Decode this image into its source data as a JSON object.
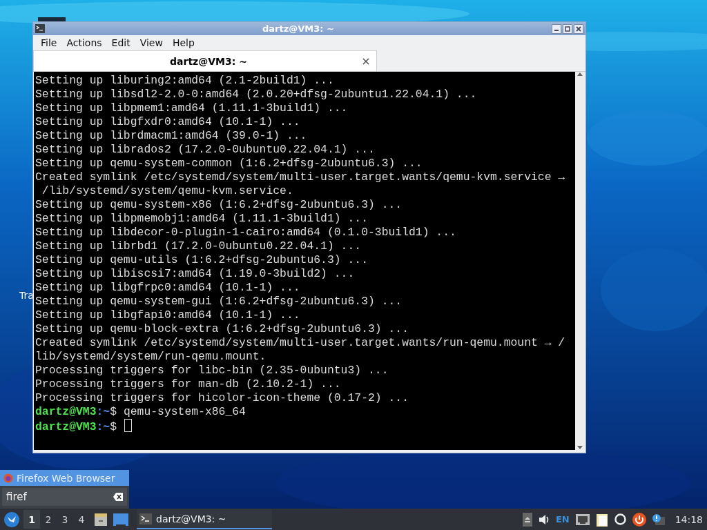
{
  "desktop": {
    "icon_labels": [
      "Tra"
    ]
  },
  "window": {
    "title": "dartz@VM3: ~",
    "menu": [
      "File",
      "Actions",
      "Edit",
      "View",
      "Help"
    ],
    "tabs": [
      {
        "label": "dartz@VM3: ~",
        "selected": true
      }
    ],
    "terminal": {
      "lines": [
        {
          "kind": "output",
          "text": "Setting up liburing2:amd64 (2.1-2build1) ..."
        },
        {
          "kind": "output",
          "text": "Setting up libsdl2-2.0-0:amd64 (2.0.20+dfsg-2ubuntu1.22.04.1) ..."
        },
        {
          "kind": "output",
          "text": "Setting up libpmem1:amd64 (1.11.1-3build1) ..."
        },
        {
          "kind": "output",
          "text": "Setting up libgfxdr0:amd64 (10.1-1) ..."
        },
        {
          "kind": "output",
          "text": "Setting up librdmacm1:amd64 (39.0-1) ..."
        },
        {
          "kind": "output",
          "text": "Setting up librados2 (17.2.0-0ubuntu0.22.04.1) ..."
        },
        {
          "kind": "output",
          "text": "Setting up qemu-system-common (1:6.2+dfsg-2ubuntu6.3) ..."
        },
        {
          "kind": "output",
          "text": "Created symlink /etc/systemd/system/multi-user.target.wants/qemu-kvm.service →"
        },
        {
          "kind": "output",
          "text": " /lib/systemd/system/qemu-kvm.service."
        },
        {
          "kind": "output",
          "text": "Setting up qemu-system-x86 (1:6.2+dfsg-2ubuntu6.3) ..."
        },
        {
          "kind": "output",
          "text": "Setting up libpmemobj1:amd64 (1.11.1-3build1) ..."
        },
        {
          "kind": "output",
          "text": "Setting up libdecor-0-plugin-1-cairo:amd64 (0.1.0-3build1) ..."
        },
        {
          "kind": "output",
          "text": "Setting up librbd1 (17.2.0-0ubuntu0.22.04.1) ..."
        },
        {
          "kind": "output",
          "text": "Setting up qemu-utils (1:6.2+dfsg-2ubuntu6.3) ..."
        },
        {
          "kind": "output",
          "text": "Setting up libiscsi7:amd64 (1.19.0-3build2) ..."
        },
        {
          "kind": "output",
          "text": "Setting up libgfrpc0:amd64 (10.1-1) ..."
        },
        {
          "kind": "output",
          "text": "Setting up qemu-system-gui (1:6.2+dfsg-2ubuntu6.3) ..."
        },
        {
          "kind": "output",
          "text": "Setting up libgfapi0:amd64 (10.1-1) ..."
        },
        {
          "kind": "output",
          "text": "Setting up qemu-block-extra (1:6.2+dfsg-2ubuntu6.3) ..."
        },
        {
          "kind": "output",
          "text": "Created symlink /etc/systemd/system/multi-user.target.wants/run-qemu.mount → /"
        },
        {
          "kind": "output",
          "text": "lib/systemd/system/run-qemu.mount."
        },
        {
          "kind": "output",
          "text": "Processing triggers for libc-bin (2.35-0ubuntu3) ..."
        },
        {
          "kind": "output",
          "text": "Processing triggers for man-db (2.10.2-1) ..."
        },
        {
          "kind": "output",
          "text": "Processing triggers for hicolor-icon-theme (0.17-2) ..."
        },
        {
          "kind": "prompt",
          "user": "dartz@VM3",
          "path": ":~",
          "symbol": "$",
          "command": "qemu-system-x86_64",
          "cursor": false
        },
        {
          "kind": "prompt",
          "user": "dartz@VM3",
          "path": ":~",
          "symbol": "$",
          "cursor": true
        }
      ]
    }
  },
  "launcher": {
    "result": "Firefox Web Browser",
    "search": {
      "value": "firef"
    }
  },
  "taskbar": {
    "workspaces": [
      {
        "label": "1",
        "selected": true
      },
      {
        "label": "2",
        "selected": false
      },
      {
        "label": "3",
        "selected": false
      },
      {
        "label": "4",
        "selected": false
      }
    ],
    "tasks": [
      {
        "label": "dartz@VM3: ~",
        "selected": true
      }
    ],
    "language": "EN",
    "clock": "14:18"
  }
}
